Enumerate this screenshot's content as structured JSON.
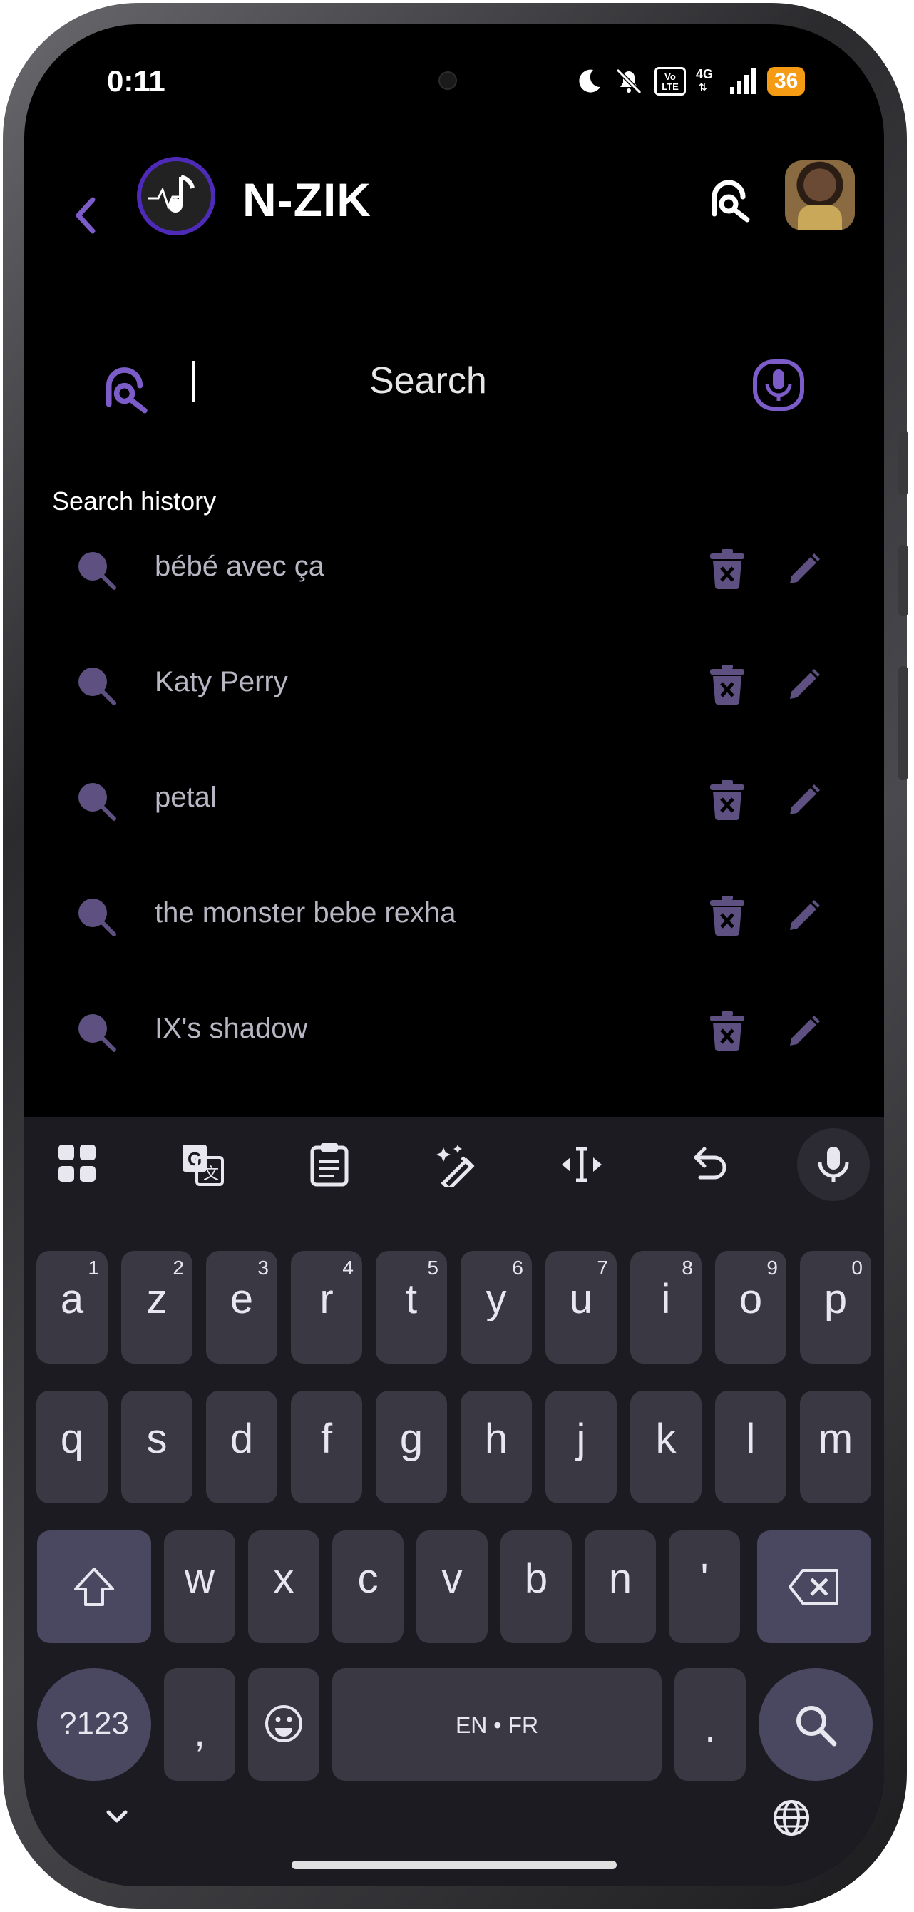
{
  "status_bar": {
    "time": "0:11",
    "battery": "36",
    "network": "4G",
    "volte": "Vo LTE"
  },
  "header": {
    "app_name": "N-ZIK",
    "back_icon": "chevron-left-icon",
    "search_icon": "music-search-icon"
  },
  "search": {
    "placeholder": "Search",
    "mic_icon": "microphone-icon"
  },
  "history": {
    "title": "Search history",
    "items": [
      "bébé avec ça",
      "Katy Perry",
      "petal",
      "the monster bebe rexha",
      "IX's shadow"
    ]
  },
  "keyboard": {
    "row1": [
      {
        "c": "a",
        "h": "1"
      },
      {
        "c": "z",
        "h": "2"
      },
      {
        "c": "e",
        "h": "3"
      },
      {
        "c": "r",
        "h": "4"
      },
      {
        "c": "t",
        "h": "5"
      },
      {
        "c": "y",
        "h": "6"
      },
      {
        "c": "u",
        "h": "7"
      },
      {
        "c": "i",
        "h": "8"
      },
      {
        "c": "o",
        "h": "9"
      },
      {
        "c": "p",
        "h": "0"
      }
    ],
    "row2": [
      "q",
      "s",
      "d",
      "f",
      "g",
      "h",
      "j",
      "k",
      "l",
      "m"
    ],
    "row3": [
      "w",
      "x",
      "c",
      "v",
      "b",
      "n",
      "'"
    ],
    "symbols_label": "?123",
    "comma_label": ",",
    "space_label": "EN • FR",
    "period_label": "."
  },
  "colors": {
    "accent": "#7b5cc9",
    "history_icon": "#5e5080",
    "keyboard_bg": "#1d1b22",
    "key_bg": "#3a3843",
    "battery": "#f59b14"
  }
}
